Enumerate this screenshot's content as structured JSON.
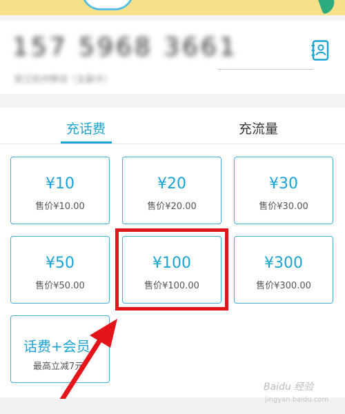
{
  "phone": {
    "number": "157 5968 3661",
    "subtext": "浙江杭州移动（主副卡）"
  },
  "tabs": {
    "recharge": "充话费",
    "data": "充流量"
  },
  "tiles": [
    {
      "amount": "¥10",
      "price": "售价¥10.00"
    },
    {
      "amount": "¥20",
      "price": "售价¥20.00"
    },
    {
      "amount": "¥30",
      "price": "售价¥30.00"
    },
    {
      "amount": "¥50",
      "price": "售价¥50.00"
    },
    {
      "amount": "¥100",
      "price": "售价¥100.00"
    },
    {
      "amount": "¥300",
      "price": "售价¥300.00"
    },
    {
      "amount": "话费+会员",
      "price": "最高立减7元"
    }
  ],
  "watermark": {
    "text": "Baidu 经验",
    "url": "jingyan.baidu.com"
  },
  "colors": {
    "accent": "#1aa3d6",
    "highlight": "#e3151a",
    "banner": "#f7e08a"
  }
}
